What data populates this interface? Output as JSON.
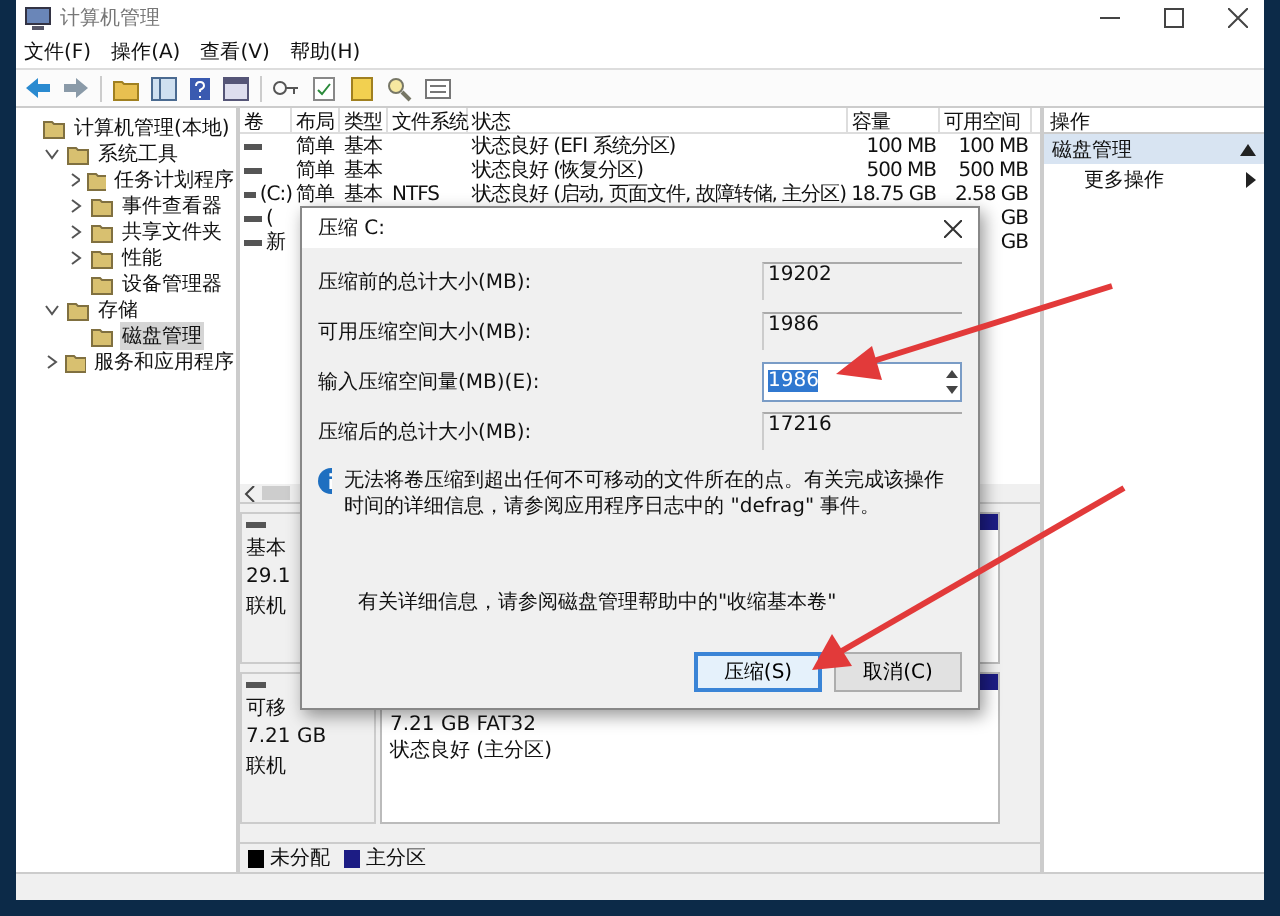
{
  "window": {
    "title": "计算机管理"
  },
  "menu": [
    "文件(F)",
    "操作(A)",
    "查看(V)",
    "帮助(H)"
  ],
  "tree": [
    {
      "label": "计算机管理(本地)",
      "selected": false,
      "children": [
        {
          "label": "系统工具",
          "expanded": true,
          "selected": false,
          "children": [
            {
              "label": "任务计划程序",
              "expanded": false,
              "selected": false
            },
            {
              "label": "事件查看器",
              "expanded": false,
              "selected": false
            },
            {
              "label": "共享文件夹",
              "expanded": false,
              "selected": false
            },
            {
              "label": "性能",
              "expanded": false,
              "selected": false
            },
            {
              "label": "设备管理器",
              "selected": false
            }
          ]
        },
        {
          "label": "存储",
          "expanded": true,
          "selected": false,
          "children": [
            {
              "label": "磁盘管理",
              "selected": true
            }
          ]
        },
        {
          "label": "服务和应用程序",
          "expanded": false,
          "selected": false
        }
      ]
    }
  ],
  "table": {
    "columns": [
      "卷",
      "布局",
      "类型",
      "文件系统",
      "状态",
      "容量",
      "可用空间"
    ],
    "rows": [
      {
        "cells": [
          null,
          "简单",
          "基本",
          null,
          "状态良好 (EFI 系统分区)",
          "100 MB",
          "100 MB"
        ]
      },
      {
        "cells": [
          null,
          "简单",
          "基本",
          null,
          "状态良好 (恢复分区)",
          "500 MB",
          "500 MB"
        ]
      },
      {
        "cells": [
          "(C:)",
          "简单",
          "基本",
          "NTFS",
          "状态良好 (启动, 页面文件, 故障转储, 主分区)",
          "18.75 GB",
          "2.58 GB"
        ]
      },
      {
        "cells": [
          "(",
          null,
          null,
          null,
          null,
          null,
          "GB"
        ]
      },
      {
        "cells": [
          "新",
          null,
          null,
          null,
          null,
          null,
          "GB"
        ]
      }
    ]
  },
  "disks": [
    {
      "labels": [
        "基本",
        "29.1",
        "联机"
      ]
    },
    {
      "labels": [
        "可移",
        "7.21 GB",
        "联机"
      ],
      "partition_lines": [
        "7.21 GB FAT32",
        "状态良好 (主分区)"
      ]
    }
  ],
  "legend": [
    {
      "label": "未分配",
      "color": "#000000"
    },
    {
      "label": "主分区",
      "color": "#1c1c84"
    }
  ],
  "actions": {
    "header": "操作",
    "items": [
      {
        "label": "磁盘管理",
        "selected": true,
        "kind": "section"
      },
      {
        "label": "更多操作",
        "selected": false,
        "kind": "submenu"
      }
    ]
  },
  "dialog": {
    "title": "压缩 C:",
    "fields": [
      {
        "label": "压缩前的总计大小(MB):",
        "value": "19202",
        "kind": "readonly"
      },
      {
        "label": "可用压缩空间大小(MB):",
        "value": "1986",
        "kind": "readonly"
      },
      {
        "label": "输入压缩空间量(MB)(E):",
        "value": "1986",
        "kind": "spin"
      },
      {
        "label": "压缩后的总计大小(MB):",
        "value": "17216",
        "kind": "readonly"
      }
    ],
    "info": "无法将卷压缩到超出任何不可移动的文件所在的点。有关完成该操作时间的详细信息，请参阅应用程序日志中的 \"defrag\" 事件。",
    "help": "有关详细信息，请参阅磁盘管理帮助中的\"收缩基本卷\"",
    "buttons": [
      {
        "label": "压缩(S)",
        "default": true
      },
      {
        "label": "取消(C)",
        "default": false
      }
    ]
  }
}
